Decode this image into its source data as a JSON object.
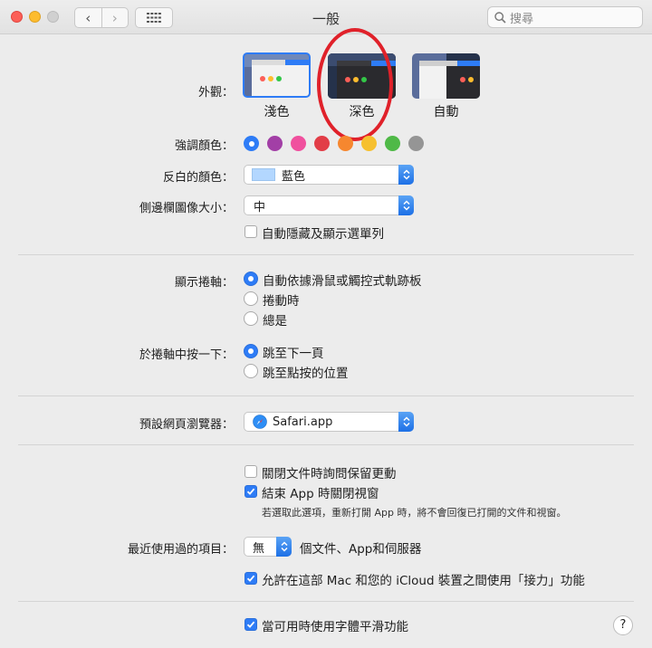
{
  "window": {
    "title": "一般",
    "search_placeholder": "搜尋"
  },
  "appearance": {
    "label": "外觀：",
    "options": [
      {
        "label": "淺色",
        "selected": true
      },
      {
        "label": "深色",
        "selected": false
      },
      {
        "label": "自動",
        "selected": false
      }
    ]
  },
  "accent": {
    "label": "強調顏色：",
    "colors": [
      "#2e7cf6",
      "#a23fa6",
      "#f0509e",
      "#e23d47",
      "#f6872f",
      "#f6c02f",
      "#4fb947",
      "#959595"
    ],
    "selected_index": 0
  },
  "highlight": {
    "label": "反白的顏色：",
    "value": "藍色",
    "swatch": "#b3d7ff"
  },
  "sidebar_icon": {
    "label": "側邊欄圖像大小：",
    "value": "中"
  },
  "auto_hide_menu": {
    "label": "自動隱藏及顯示選單列",
    "checked": false
  },
  "show_scrollbars": {
    "label": "顯示捲軸：",
    "options": [
      {
        "label": "自動依據滑鼠或觸控式軌跡板",
        "selected": true
      },
      {
        "label": "捲動時",
        "selected": false
      },
      {
        "label": "總是",
        "selected": false
      }
    ]
  },
  "click_scrollbar": {
    "label": "於捲軸中按一下：",
    "options": [
      {
        "label": "跳至下一頁",
        "selected": true
      },
      {
        "label": "跳至點按的位置",
        "selected": false
      }
    ]
  },
  "default_browser": {
    "label": "預設網頁瀏覽器：",
    "value": "Safari.app"
  },
  "ask_keep_changes": {
    "label": "關閉文件時詢問保留更動",
    "checked": false
  },
  "close_windows": {
    "label": "結束 App 時關閉視窗",
    "checked": true
  },
  "close_windows_note": "若選取此選項，重新打開 App 時，將不會回復已打開的文件和視窗。",
  "recent_items": {
    "label": "最近使用過的項目：",
    "value": "無",
    "suffix": "個文件、App和伺服器"
  },
  "handoff": {
    "label": "允許在這部 Mac 和您的 iCloud 裝置之間使用「接力」功能",
    "checked": true
  },
  "font_smoothing": {
    "label": "當可用時使用字體平滑功能",
    "checked": true
  },
  "help": "?"
}
